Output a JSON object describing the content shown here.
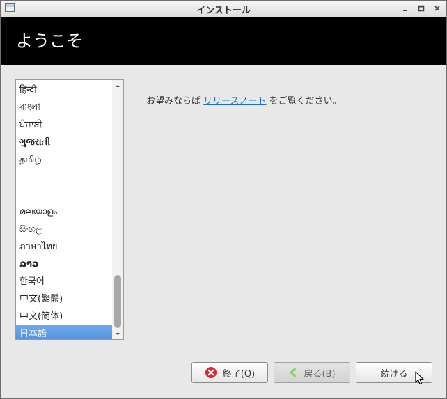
{
  "window": {
    "title": "インストール",
    "app_icon": "window-app-icon",
    "controls": [
      "minimize-icon",
      "maximize-icon",
      "close-icon"
    ]
  },
  "header": {
    "title": "ようこそ"
  },
  "language_list": {
    "items": [
      {
        "label": "हिन्दी",
        "bold": false,
        "selected": false
      },
      {
        "label": "বাংলা",
        "bold": false,
        "selected": false
      },
      {
        "label": "ਪੰਜਾਬੀ",
        "bold": false,
        "selected": false
      },
      {
        "label": "ગુજરાતી",
        "bold": true,
        "selected": false
      },
      {
        "label": "தமிழ்",
        "bold": false,
        "selected": false
      },
      {
        "label": "",
        "bold": false,
        "selected": false
      },
      {
        "label": "",
        "bold": false,
        "selected": false
      },
      {
        "label": "മലയാളം",
        "bold": false,
        "selected": false
      },
      {
        "label": "සිංහල",
        "bold": false,
        "selected": false
      },
      {
        "label": "ภาษาไทย",
        "bold": false,
        "selected": false
      },
      {
        "label": "ລາວ",
        "bold": true,
        "selected": false
      },
      {
        "label": "한국어",
        "bold": false,
        "selected": false
      },
      {
        "label": "中文(繁體)",
        "bold": false,
        "selected": false
      },
      {
        "label": "中文(简体)",
        "bold": false,
        "selected": false
      },
      {
        "label": "日本語",
        "bold": false,
        "selected": true
      }
    ],
    "selection_color": "#5b9be1"
  },
  "release_notes": {
    "prefix": "お望みならば ",
    "link": "リリースノート",
    "suffix": " をご覧ください。"
  },
  "buttons": {
    "quit_label": "終了(Q)",
    "back_label": "戻る(B)",
    "continue_label": "続ける"
  },
  "colors": {
    "header_bg": "#000000",
    "link": "#1f6fc6"
  }
}
